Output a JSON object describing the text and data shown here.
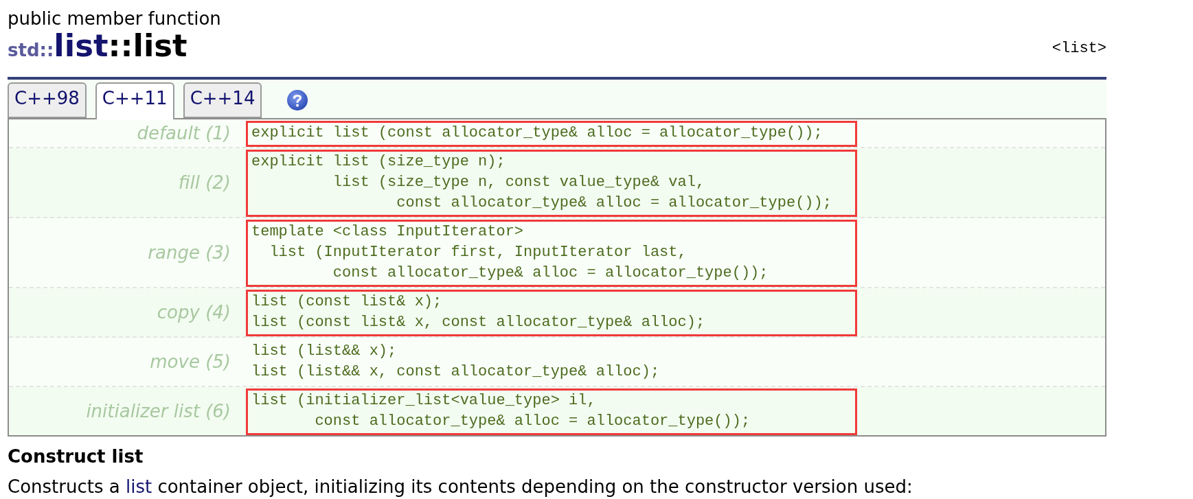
{
  "header": {
    "kind": "public member function",
    "title": {
      "namespace": "std::",
      "class": "list",
      "member": "::list"
    },
    "header_ref": "<list>"
  },
  "tabs": [
    {
      "label": "C++98",
      "selected": false
    },
    {
      "label": "C++11",
      "selected": true
    },
    {
      "label": "C++14",
      "selected": false
    }
  ],
  "signatures": [
    {
      "label": "default (1)",
      "lines": [
        "explicit list (const allocator_type& alloc = allocator_type());"
      ],
      "highlighted": true
    },
    {
      "label": "fill (2)",
      "lines": [
        "explicit list (size_type n);",
        "         list (size_type n, const value_type& val,",
        "                const allocator_type& alloc = allocator_type());"
      ],
      "highlighted": true
    },
    {
      "label": "range (3)",
      "lines": [
        "template <class InputIterator>",
        "  list (InputIterator first, InputIterator last,",
        "         const allocator_type& alloc = allocator_type());"
      ],
      "highlighted": true
    },
    {
      "label": "copy (4)",
      "lines": [
        "list (const list& x);",
        "list (const list& x, const allocator_type& alloc);"
      ],
      "highlighted": true
    },
    {
      "label": "move (5)",
      "lines": [
        "list (list&& x);",
        "list (list&& x, const allocator_type& alloc);"
      ],
      "highlighted": false
    },
    {
      "label": "initializer list (6)",
      "lines": [
        "list (initializer_list<value_type> il,",
        "       const allocator_type& alloc = allocator_type());"
      ],
      "highlighted": true
    }
  ],
  "description": {
    "heading": "Construct list",
    "text_before": "Constructs a",
    "link": "list",
    "text_after": "container object, initializing its contents depending on the constructor version used:"
  }
}
